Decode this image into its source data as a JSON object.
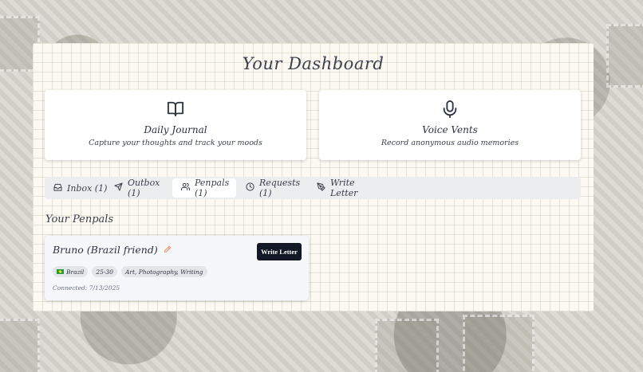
{
  "dashboard": {
    "title": "Your Dashboard"
  },
  "cards": [
    {
      "title": "Daily Journal",
      "description": "Capture your thoughts and track your moods",
      "icon": "book-open-icon"
    },
    {
      "title": "Voice Vents",
      "description": "Record anonymous audio memories",
      "icon": "microphone-icon"
    }
  ],
  "tabs": [
    {
      "label": "Inbox (1)",
      "icon": "inbox-icon"
    },
    {
      "label": "Outbox (1)",
      "icon": "send-icon"
    },
    {
      "label": "Penpals (1)",
      "icon": "users-icon",
      "active": true
    },
    {
      "label": "Requests (1)",
      "icon": "clock-icon"
    },
    {
      "label": "Write Letter",
      "icon": "pen-nib-icon"
    }
  ],
  "penpals": {
    "section_title": "Your Penpals",
    "items": [
      {
        "name": "Bruno (Brazil friend)",
        "write_button": "Write Letter",
        "country": "Brazil",
        "age_range": "25-30",
        "interests": "Art, Photography, Writing",
        "connected": "Connected: 7/13/2025"
      }
    ]
  },
  "colors": {
    "button_bg": "#121826",
    "edit_icon": "#e8956a",
    "flag_green": "#1f9b3a"
  }
}
